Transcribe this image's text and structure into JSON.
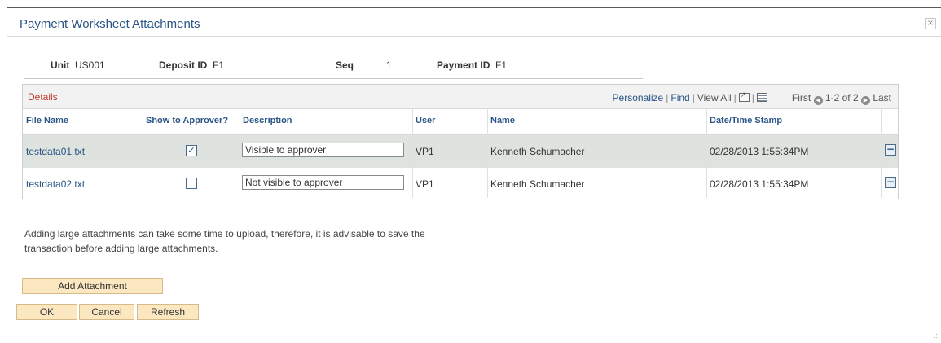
{
  "window": {
    "title": "Payment Worksheet Attachments",
    "close_icon": "×"
  },
  "header": {
    "unit_label": "Unit",
    "unit_value": "US001",
    "deposit_label": "Deposit ID",
    "deposit_value": "F1",
    "seq_label": "Seq",
    "seq_value": "1",
    "payment_label": "Payment ID",
    "payment_value": "F1"
  },
  "grid": {
    "title": "Details",
    "nav": {
      "personalize": "Personalize",
      "find": "Find",
      "view_all": "View All",
      "first": "First",
      "range": "1-2 of 2",
      "last": "Last"
    },
    "columns": [
      "File Name",
      "Show to Approver?",
      "Description",
      "User",
      "Name",
      "Date/Time Stamp"
    ],
    "rows": [
      {
        "file_name": "testdata01.txt",
        "show": true,
        "description": "Visible to approver",
        "user": "VP1",
        "name": "Kenneth Schumacher",
        "timestamp": "02/28/2013  1:55:34PM"
      },
      {
        "file_name": "testdata02.txt",
        "show": false,
        "description": "Not visible to approver",
        "user": "VP1",
        "name": "Kenneth Schumacher",
        "timestamp": "02/28/2013  1:55:34PM"
      }
    ]
  },
  "notice": {
    "line1": "Adding large attachments can take some time to upload, therefore, it is advisable to save the",
    "line2": "transaction before adding large attachments."
  },
  "buttons": {
    "add_attachment": "Add Attachment",
    "ok": "OK",
    "cancel": "Cancel",
    "refresh": "Refresh"
  },
  "colors": {
    "accent": "#2a5586",
    "grid_title": "#c0392b",
    "button_bg": "#fbe8c0",
    "row_highlight": "#dfe3df"
  }
}
